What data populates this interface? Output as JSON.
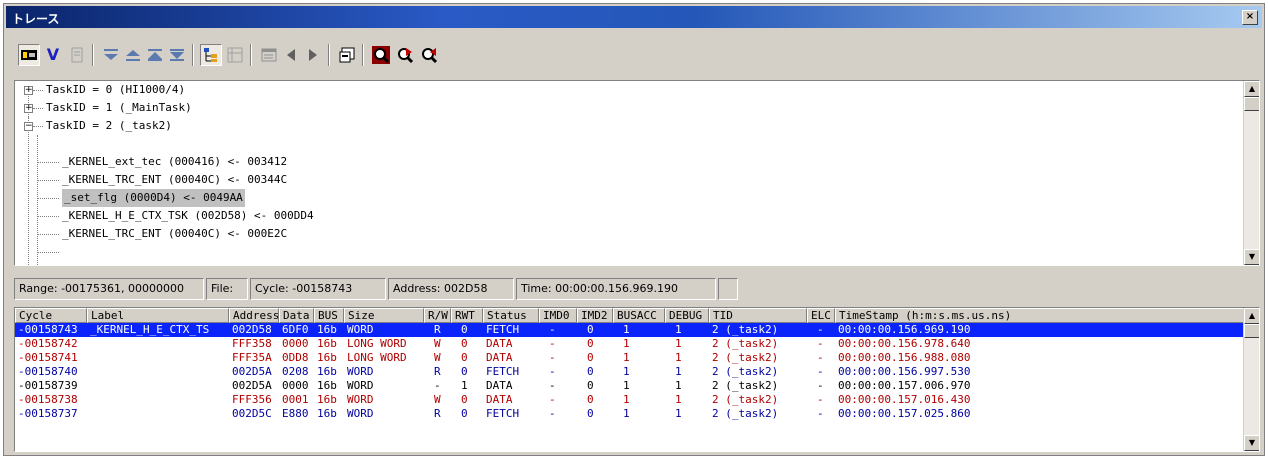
{
  "window": {
    "title": "トレース",
    "close_glyph": "×"
  },
  "toolbar": {
    "icons": [
      "stop-icon",
      "v-icon",
      "copy-icon",
      "filter-down-icon",
      "filter-up-icon",
      "move-up-icon",
      "move-down-icon",
      "tree-icon",
      "tree2-icon",
      "window-icon",
      "prev-icon",
      "next-icon",
      "properties-icon",
      "find-icon",
      "find-next-icon",
      "find-prev-icon"
    ]
  },
  "tree": {
    "items": [
      {
        "level": 0,
        "expander": "+",
        "text": "TaskID = 0 (HI1000/4)"
      },
      {
        "level": 0,
        "expander": "+",
        "text": "TaskID = 1 (_MainTask)"
      },
      {
        "level": 0,
        "expander": "-",
        "text": "TaskID = 2 (_task2)"
      },
      {
        "level": 1,
        "text": "_KERNEL_ext_tec (000416) <- 003412"
      },
      {
        "level": 1,
        "text": "_KERNEL_TRC_ENT (00040C) <- 00344C"
      },
      {
        "level": 1,
        "text": "_set_flg (0000D4) <- 0049AA",
        "selected": true
      },
      {
        "level": 1,
        "text": "_KERNEL_H_E_CTX_TSK (002D58) <- 000DD4"
      },
      {
        "level": 1,
        "text": "_KERNEL_TRC_ENT (00040C) <- 000E2C"
      }
    ]
  },
  "status": {
    "range": "Range: -00175361, 00000000",
    "file": "File:",
    "cycle": "Cycle: -00158743",
    "address": "Address: 002D58",
    "time": "Time: 00:00:00.156.969.190"
  },
  "grid": {
    "columns": [
      "Cycle",
      "Label",
      "Address",
      "Data",
      "BUS",
      "Size",
      "R/W",
      "RWT",
      "Status",
      "IMD0",
      "IMD2",
      "BUSACC",
      "DEBUG",
      "TID",
      "ELC",
      "TimeStamp (h:m:s.ms.us.ns)"
    ],
    "rows": [
      {
        "cycle": "-00158743",
        "label": "_KERNEL_H_E_CTX_TS",
        "address": "002D58",
        "data": "6DF0",
        "bus": "16b",
        "size": "WORD",
        "rw": "R",
        "rwt": "0",
        "status": "FETCH",
        "imd0": "-",
        "imd2": "0",
        "busacc": "1",
        "debug": "1",
        "tid": "2 (_task2)",
        "elc": "-",
        "ts": "00:00:00.156.969.190",
        "color": "blue",
        "selected": true
      },
      {
        "cycle": "-00158742",
        "label": "",
        "address": "FFF358",
        "data": "0000",
        "bus": "16b",
        "size": "LONG WORD",
        "rw": "W",
        "rwt": "0",
        "status": "DATA",
        "imd0": "-",
        "imd2": "0",
        "busacc": "1",
        "debug": "1",
        "tid": "2 (_task2)",
        "elc": "-",
        "ts": "00:00:00.156.978.640",
        "color": "red"
      },
      {
        "cycle": "-00158741",
        "label": "",
        "address": "FFF35A",
        "data": "0DD8",
        "bus": "16b",
        "size": "LONG WORD",
        "rw": "W",
        "rwt": "0",
        "status": "DATA",
        "imd0": "-",
        "imd2": "0",
        "busacc": "1",
        "debug": "1",
        "tid": "2 (_task2)",
        "elc": "-",
        "ts": "00:00:00.156.988.080",
        "color": "red"
      },
      {
        "cycle": "-00158740",
        "label": "",
        "address": "002D5A",
        "data": "0208",
        "bus": "16b",
        "size": "WORD",
        "rw": "R",
        "rwt": "0",
        "status": "FETCH",
        "imd0": "-",
        "imd2": "0",
        "busacc": "1",
        "debug": "1",
        "tid": "2 (_task2)",
        "elc": "-",
        "ts": "00:00:00.156.997.530",
        "color": "blue"
      },
      {
        "cycle": "-00158739",
        "label": "",
        "address": "002D5A",
        "data": "0000",
        "bus": "16b",
        "size": "WORD",
        "rw": "-",
        "rwt": "1",
        "status": "DATA",
        "imd0": "-",
        "imd2": "0",
        "busacc": "1",
        "debug": "1",
        "tid": "2 (_task2)",
        "elc": "-",
        "ts": "00:00:00.157.006.970",
        "color": "black"
      },
      {
        "cycle": "-00158738",
        "label": "",
        "address": "FFF356",
        "data": "0001",
        "bus": "16b",
        "size": "WORD",
        "rw": "W",
        "rwt": "0",
        "status": "DATA",
        "imd0": "-",
        "imd2": "0",
        "busacc": "1",
        "debug": "1",
        "tid": "2 (_task2)",
        "elc": "-",
        "ts": "00:00:00.157.016.430",
        "color": "red"
      },
      {
        "cycle": "-00158737",
        "label": "",
        "address": "002D5C",
        "data": "E880",
        "bus": "16b",
        "size": "WORD",
        "rw": "R",
        "rwt": "0",
        "status": "FETCH",
        "imd0": "-",
        "imd2": "0",
        "busacc": "1",
        "debug": "1",
        "tid": "2 (_task2)",
        "elc": "-",
        "ts": "00:00:00.157.025.860",
        "color": "blue"
      }
    ]
  },
  "colors": {
    "selection": "#0b24fb",
    "write": "#b00000",
    "fetch": "#0000a0",
    "title_start": "#0a246a"
  }
}
